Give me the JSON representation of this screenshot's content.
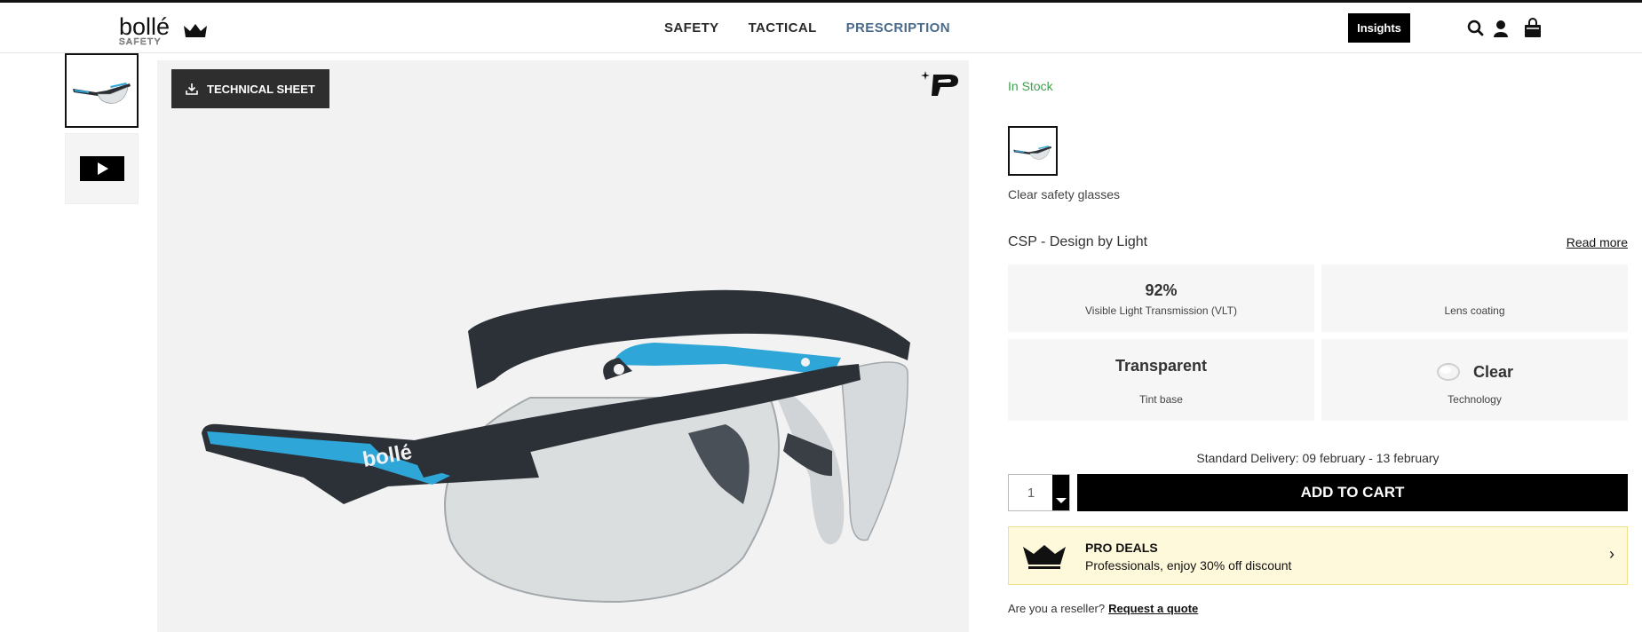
{
  "brand": {
    "logo_text": "bollé",
    "logo_sub": "SAFETY"
  },
  "nav": {
    "items": [
      {
        "label": "SAFETY"
      },
      {
        "label": "TACTICAL"
      },
      {
        "label": "PRESCRIPTION"
      }
    ],
    "insights_label": "Insights",
    "icons": [
      "search-icon",
      "user-icon",
      "cart-icon"
    ]
  },
  "gallery": {
    "technical_sheet_label": "TECHNICAL SHEET",
    "thumbnails": [
      "glasses-thumbnail",
      "video-thumbnail"
    ],
    "temple_logo": "bollé"
  },
  "product": {
    "stock_status": "In Stock",
    "variant_name": "Clear safety glasses",
    "csp_title": "CSP - Design by Light",
    "read_more": "Read more",
    "specs": {
      "vlt_value": "92%",
      "vlt_label": "Visible Light Transmission (VLT)",
      "coating_label": "Lens coating",
      "tint_value": "Transparent",
      "tint_label": "Tint base",
      "tech_value": "Clear",
      "tech_label": "Technology"
    },
    "delivery": "Standard Delivery: 09 february - 13 february",
    "quantity": "1",
    "add_to_cart": "ADD TO CART"
  },
  "pro_deals": {
    "title": "PRO DEALS",
    "text": "Professionals, enjoy 30% off discount",
    "chevron": "›"
  },
  "reseller": {
    "question": "Are you a reseller?",
    "link": "Request a quote"
  },
  "colors": {
    "stock_green": "#3fa04c",
    "prescription_blue": "#4a6a8a",
    "pro_deals_bg": "#fff9db",
    "frame_blue": "#2fa6d8"
  }
}
